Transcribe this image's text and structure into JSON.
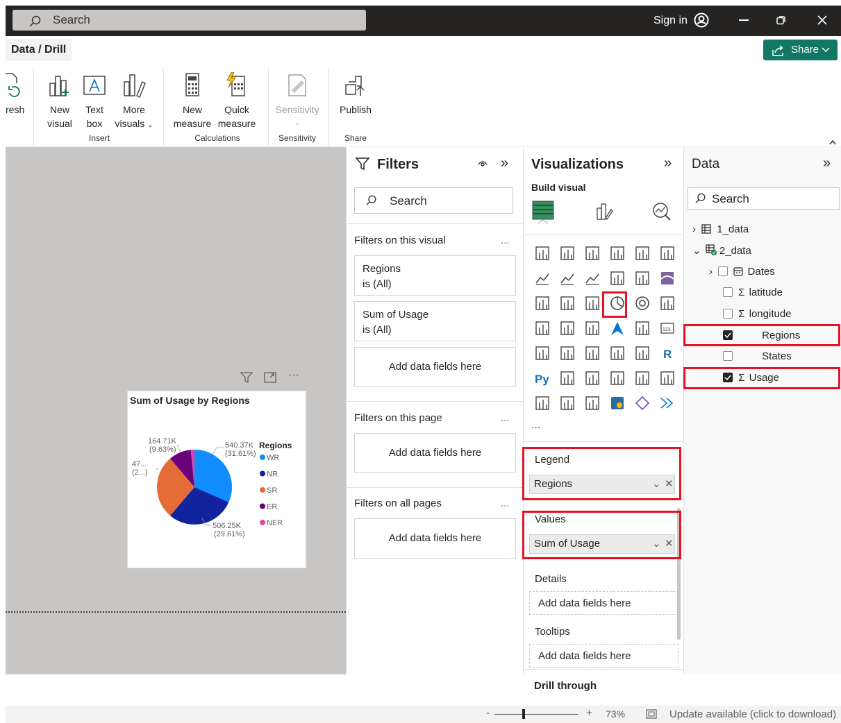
{
  "titlebar": {
    "search_placeholder": "Search",
    "sign_in": "Sign in"
  },
  "breadcrumb": "Data / Drill",
  "share_label": "Share",
  "ribbon": {
    "refresh": "resh",
    "new_visual": [
      "New",
      "visual"
    ],
    "text_box": [
      "Text",
      "box"
    ],
    "more_visuals": [
      "More",
      "visuals"
    ],
    "new_measure": [
      "New",
      "measure"
    ],
    "quick_measure": [
      "Quick",
      "measure"
    ],
    "sensitivity": "Sensitivity",
    "publish": "Publish",
    "groups": {
      "insert": "Insert",
      "calculations": "Calculations",
      "sensitivity": "Sensitivity",
      "share": "Share"
    }
  },
  "filters": {
    "title": "Filters",
    "search_placeholder": "Search",
    "on_visual": "Filters on this visual",
    "card1": {
      "name": "Regions",
      "state": "is (All)"
    },
    "card2": {
      "name": "Sum of Usage",
      "state": "is (All)"
    },
    "add_fields": "Add data fields here",
    "on_page": "Filters on this page",
    "on_all": "Filters on all pages",
    "dots": "..."
  },
  "viz": {
    "title": "Visualizations",
    "build_visual": "Build visual",
    "more": "...",
    "legend_label": "Legend",
    "legend_value": "Regions",
    "values_label": "Values",
    "values_value": "Sum of Usage",
    "details_label": "Details",
    "tooltips_label": "Tooltips",
    "add_fields": "Add data fields here",
    "drill_through": "Drill through"
  },
  "data": {
    "title": "Data",
    "search_placeholder": "Search",
    "tables": [
      "1_data",
      "2_data"
    ],
    "fields": {
      "dates": "Dates",
      "latitude": "latitude",
      "longitude": "longitude",
      "regions": "Regions",
      "states": "States",
      "usage": "Usage"
    },
    "checked": {
      "regions": true,
      "usage": true
    }
  },
  "visual": {
    "title": "Sum of Usage by Regions",
    "legend_title": "Regions",
    "labels": {
      "wr": [
        "540.37K",
        "(31.61%)"
      ],
      "nr": [
        "506.25K",
        "(29.61%)"
      ],
      "er": [
        "164.71K",
        "(9.63%)"
      ],
      "sr": [
        "47...",
        "(2...)"
      ]
    }
  },
  "chart_data": {
    "type": "pie",
    "title": "Sum of Usage by Regions",
    "categories": [
      "WR",
      "NR",
      "SR",
      "ER",
      "NER"
    ],
    "values": [
      540.37,
      506.25,
      471,
      164.71,
      27
    ],
    "units": "K",
    "colors": [
      "#118dff",
      "#12239e",
      "#e66c37",
      "#6b007b",
      "#e044a7"
    ],
    "legend": "right"
  },
  "status": {
    "zoom": "73%",
    "update": "Update available (click to download)"
  }
}
